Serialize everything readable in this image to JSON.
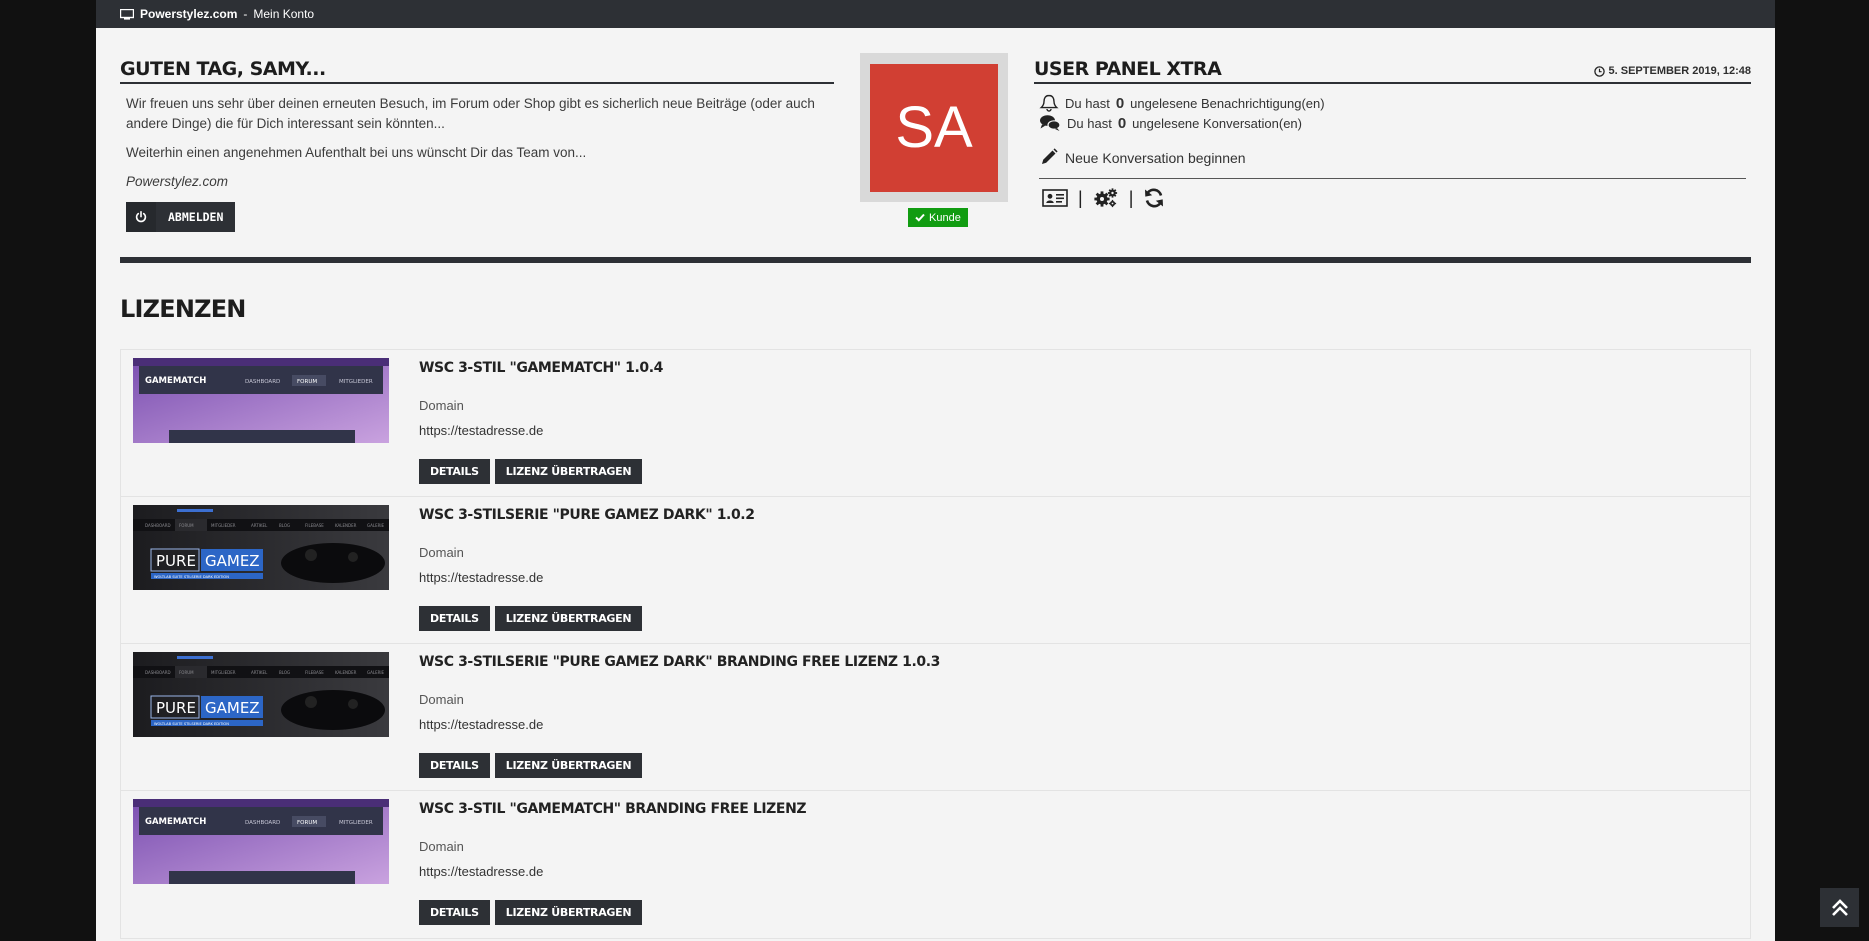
{
  "topbar": {
    "site": "Powerstylez.com",
    "separator": "-",
    "page": "Mein Konto"
  },
  "greeting": {
    "title": "Guten Tag, Samy...",
    "text1": "Wir freuen uns sehr über deinen erneuten Besuch, im Forum oder Shop gibt es sicherlich neue Beiträge (oder auch andere Dinge) die für Dich interessant sein könnten...",
    "text2": "Weiterhin einen angenehmen Aufenthalt bei uns wünscht Dir das Team von...",
    "signature": "Powerstylez.com",
    "logout_label": "ABMELDEN"
  },
  "avatar": {
    "initials": "SA",
    "badge": "Kunde",
    "colors": {
      "avatar": "#d13f33",
      "badge": "#119c11"
    }
  },
  "panel": {
    "title": "User Panel Xtra",
    "datetime": "5. SEPTEMBER 2019, 12:48",
    "notifications": {
      "prefix": "Du hast",
      "count": "0",
      "suffix": "ungelesene Benachrichtigung(en)"
    },
    "conversations": {
      "prefix": "Du hast",
      "count": "0",
      "suffix": "ungelesene Konversation(en)"
    },
    "new_conversation": "Neue Konversation beginnen",
    "toolbar_icons": [
      "id-card-icon",
      "cogs-icon",
      "refresh-icon"
    ]
  },
  "licenses": {
    "title": "Lizenzen",
    "domain_label": "Domain",
    "details_label": "DETAILS",
    "transfer_label": "LIZENZ ÜBERTRAGEN",
    "items": [
      {
        "name": "WSC 3-Stil \"Gamematch\" 1.0.4",
        "domain": "https://testadresse.de",
        "thumb": "gamematch",
        "thumb_text": {
          "logo": "GAMEMATCH",
          "nav1": "DASHBOARD",
          "nav2": "FORUM",
          "nav3": "MITGLIEDER"
        }
      },
      {
        "name": "WSC 3-Stilserie \"Pure Gamez Dark\" 1.0.2",
        "domain": "https://testadresse.de",
        "thumb": "puregamez",
        "thumb_text": {
          "logo1": "PURE",
          "logo2": "GAMEZ",
          "tagline": "WOLTLAB SUITE STILSERIE DARK EDITION",
          "nav": [
            "DASHBOARD",
            "FORUM",
            "MITGLIEDER",
            "ARTIKEL",
            "BLOG",
            "FILEBASE",
            "KALENDER",
            "GALERIE"
          ]
        }
      },
      {
        "name": "WSC 3-Stilserie \"Pure Gamez Dark\" Branding Free Lizenz 1.0.3",
        "domain": "https://testadresse.de",
        "thumb": "puregamez",
        "thumb_text": {
          "logo1": "PURE",
          "logo2": "GAMEZ",
          "tagline": "WOLTLAB SUITE STILSERIE DARK EDITION",
          "nav": [
            "DASHBOARD",
            "FORUM",
            "MITGLIEDER",
            "ARTIKEL",
            "BLOG",
            "FILEBASE",
            "KALENDER",
            "GALERIE"
          ]
        }
      },
      {
        "name": "WSC 3-Stil \"Gamematch\" Branding Free Lizenz",
        "domain": "https://testadresse.de",
        "thumb": "gamematch",
        "thumb_text": {
          "logo": "GAMEMATCH",
          "nav1": "DASHBOARD",
          "nav2": "FORUM",
          "nav3": "MITGLIEDER"
        }
      }
    ]
  },
  "colors": {
    "dark": "#2d3035",
    "page_bg": "#f4f4f4",
    "outer_bg": "#111111"
  }
}
